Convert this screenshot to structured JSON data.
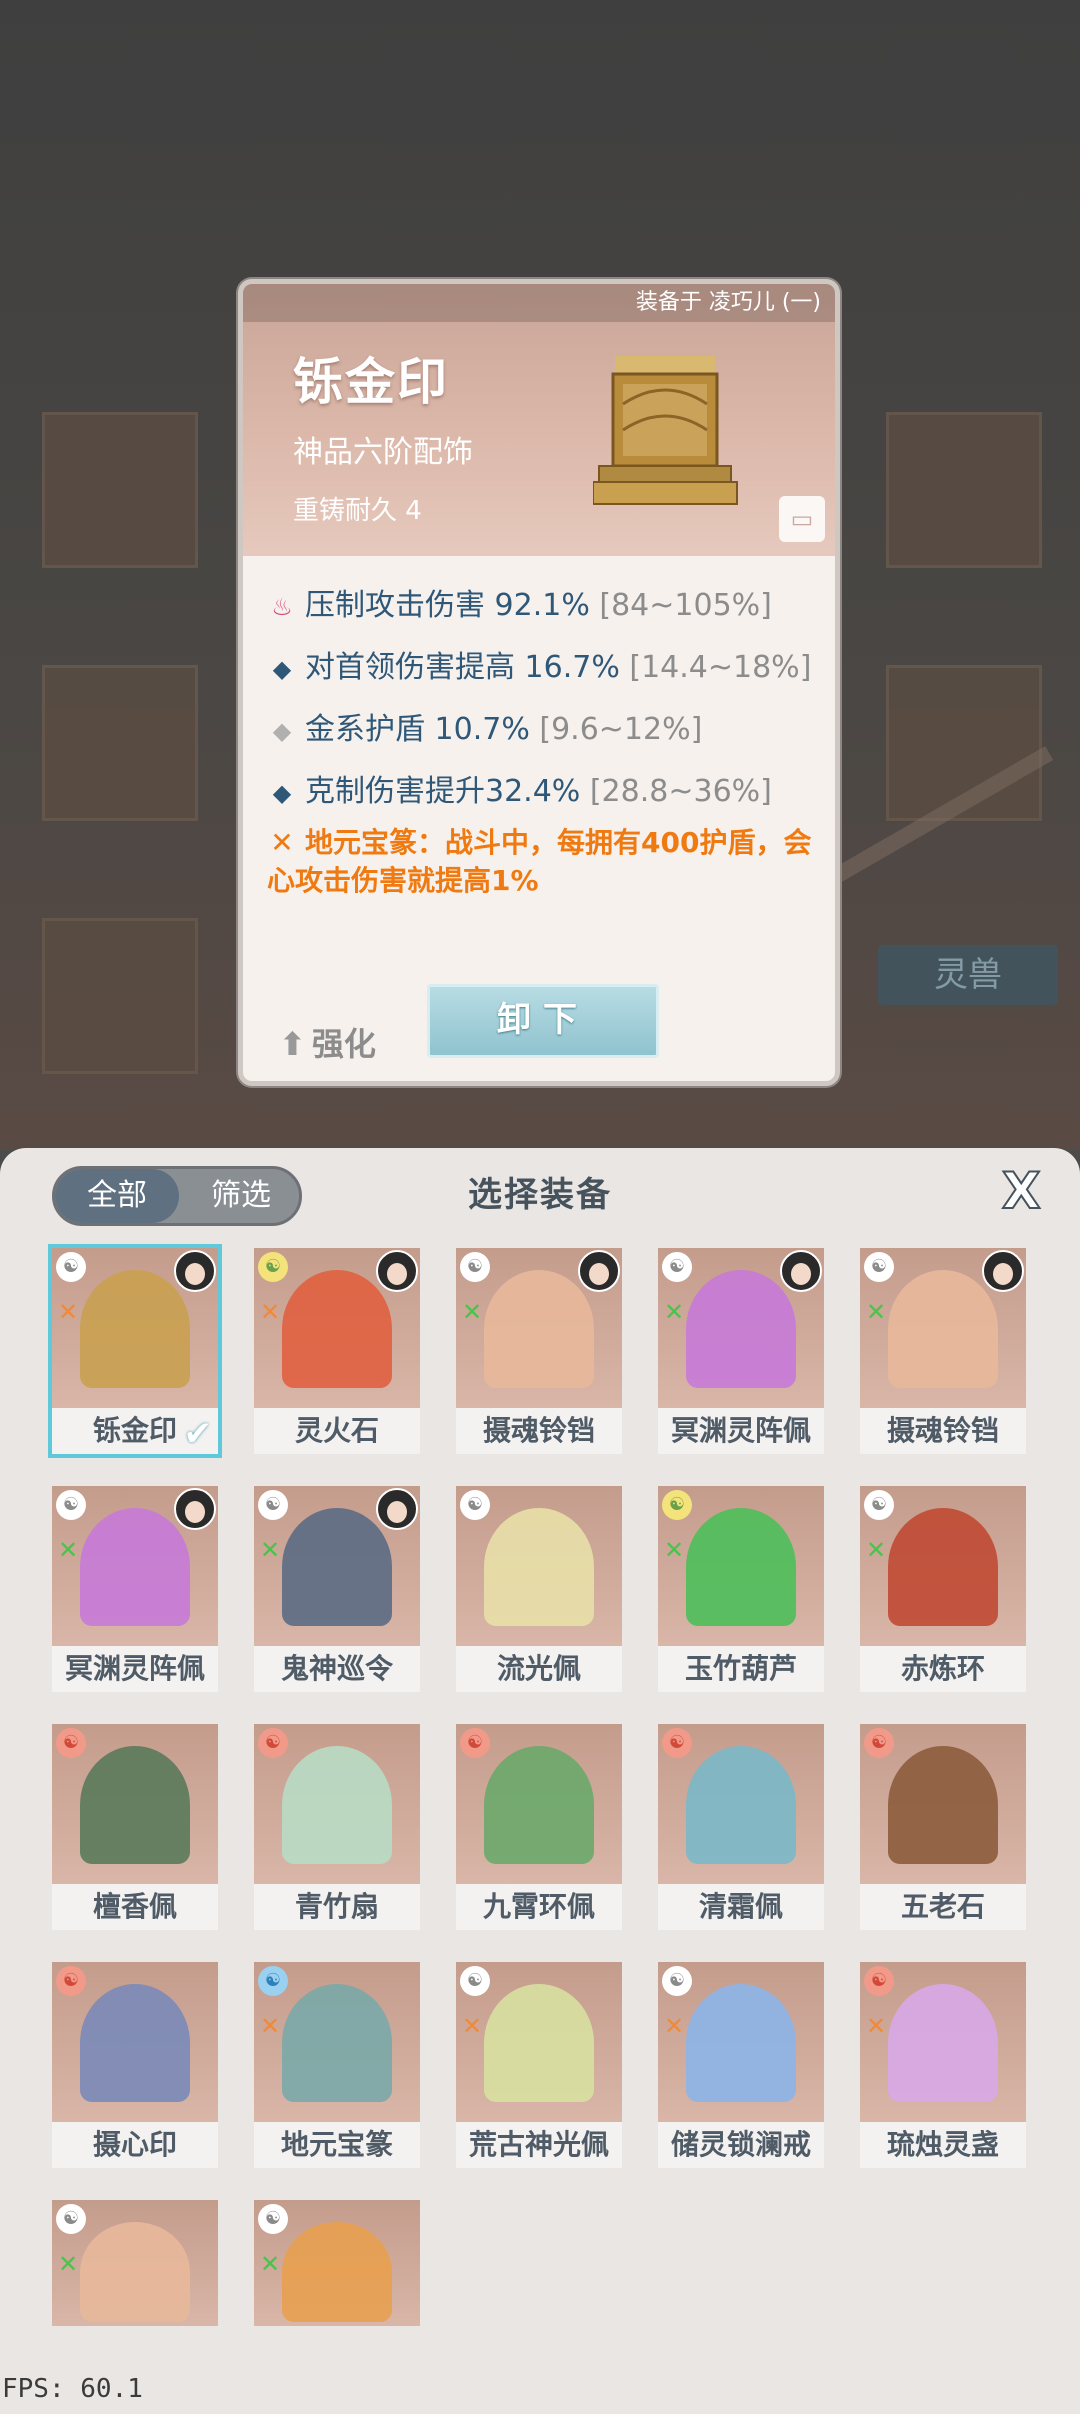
{
  "card": {
    "equipped_on": "装备于 凌巧儿 (一)",
    "name": "铄金印",
    "grade": "神品六阶配饰",
    "recast": "重铸耐久 4",
    "stats": [
      {
        "text": "压制攻击伤害 92.1% ",
        "range": "[84~105%]",
        "icon": "flame-icon",
        "color": "#d2487a"
      },
      {
        "text": "对首领伤害提高 16.7% ",
        "range": "[14.4~18%]",
        "icon": "diamond-icon",
        "color": "#2f5778"
      },
      {
        "text": "金系护盾 10.7% ",
        "range": "[9.6~12%]",
        "icon": "diamond-gray-icon",
        "color": "#b0b0b0"
      },
      {
        "text": "克制伤害提升32.4% ",
        "range": "[28.8~36%]",
        "icon": "diamond-icon",
        "color": "#2f5778"
      }
    ],
    "skill": "地元宝篆：战斗中，每拥有400护盾，会心攻击伤害就提高1%",
    "strengthen": "强化",
    "unequip": "卸下"
  },
  "sheet": {
    "tab_all": "全部",
    "tab_filter": "筛选",
    "title": "选择装备",
    "close": "X",
    "items": [
      {
        "label": "铄金印",
        "elem": "white",
        "owner": true,
        "selected": true,
        "mark": "orange"
      },
      {
        "label": "灵火石",
        "elem": "yellow",
        "owner": true,
        "mark": "orange"
      },
      {
        "label": "摄魂铃铛",
        "elem": "white",
        "owner": true,
        "mark": "green"
      },
      {
        "label": "冥渊灵阵佩",
        "elem": "white",
        "owner": true,
        "mark": "green"
      },
      {
        "label": "摄魂铃铛",
        "elem": "white",
        "owner": true,
        "mark": "green"
      },
      {
        "label": "冥渊灵阵佩",
        "elem": "white",
        "owner": true,
        "mark": "green"
      },
      {
        "label": "鬼神巡令",
        "elem": "white",
        "owner": true,
        "mark": "green"
      },
      {
        "label": "流光佩",
        "elem": "white"
      },
      {
        "label": "玉竹葫芦",
        "elem": "yellow",
        "mark": "green"
      },
      {
        "label": "赤炼环",
        "elem": "white",
        "mark": "green"
      },
      {
        "label": "檀香佩",
        "elem": "red"
      },
      {
        "label": "青竹扇",
        "elem": "red"
      },
      {
        "label": "九霄环佩",
        "elem": "red"
      },
      {
        "label": "清霜佩",
        "elem": "red"
      },
      {
        "label": "五老石",
        "elem": "red"
      },
      {
        "label": "摄心印",
        "elem": "red"
      },
      {
        "label": "地元宝篆",
        "elem": "blue",
        "mark": "orange"
      },
      {
        "label": "荒古神光佩",
        "elem": "white",
        "mark": "orange"
      },
      {
        "label": "储灵锁澜戒",
        "elem": "white",
        "mark": "orange"
      },
      {
        "label": "琉烛灵盏",
        "elem": "red",
        "mark": "orange"
      },
      {
        "label": "",
        "elem": "white",
        "mark": "green"
      },
      {
        "label": "",
        "elem": "white",
        "mark": "green"
      }
    ]
  },
  "fps": "FPS: 60.1"
}
